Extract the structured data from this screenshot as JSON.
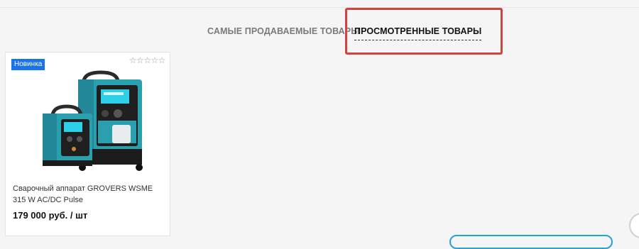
{
  "tabs": {
    "bestsellers": "САМЫЕ ПРОДАВАЕМЫЕ ТОВАРЫ",
    "viewed": "ПРОСМОТРЕННЫЕ ТОВАРЫ"
  },
  "product": {
    "badge": "Новинка",
    "stars": "☆☆☆☆☆",
    "title": "Сварочный аппарат GROVERS WSME 315 W AC/DC Pulse",
    "price": "179 000 руб. / шт",
    "brand_text": "GROVERS",
    "rating": 0,
    "rating_max": 5
  },
  "colors": {
    "accent_blue": "#1a73e8",
    "highlight_red": "#d0443d",
    "product_teal": "#2a9fae",
    "button_border": "#25a3e0"
  },
  "icons": {
    "rating": "star-outline-icon"
  }
}
